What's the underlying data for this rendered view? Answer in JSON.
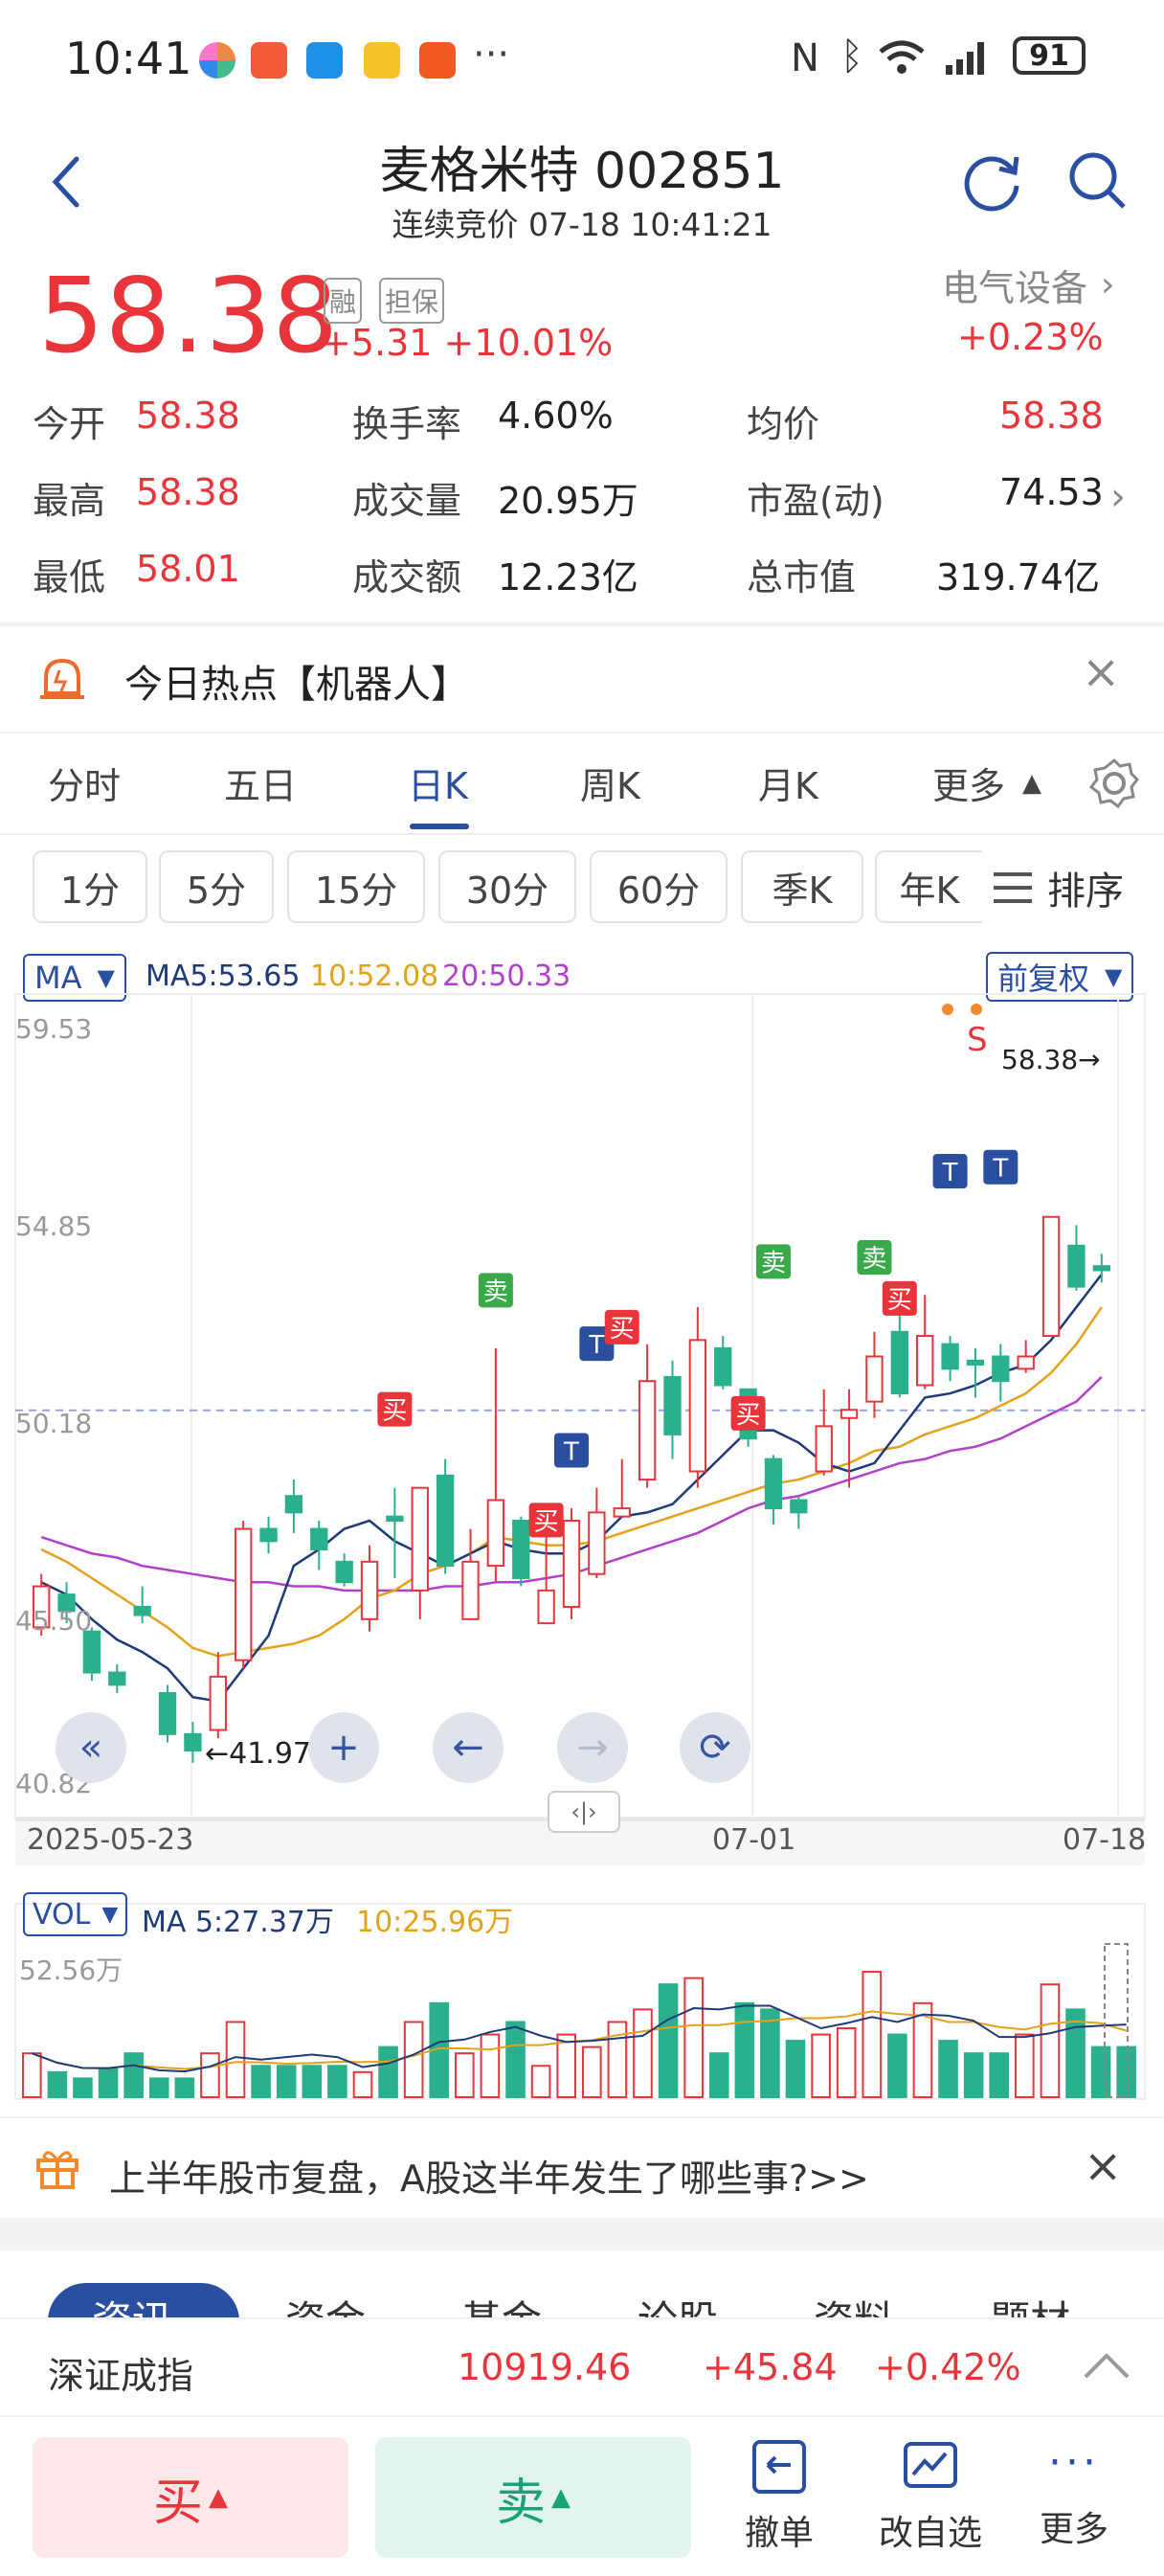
{
  "status_bar": {
    "time": "10:41",
    "battery": "91",
    "dots": "···"
  },
  "header": {
    "title": "麦格米特 002851",
    "subtitle": "连续竞价 07-18 10:41:21"
  },
  "quote": {
    "price": "58.38",
    "tag_rong": "融",
    "tag_danbao": "担保",
    "change": "+5.31",
    "change_pct": "+10.01%",
    "sector": "电气设备",
    "sector_pct": "+0.23%"
  },
  "stats": [
    {
      "label": "今开",
      "value": "58.38"
    },
    {
      "label": "换手率",
      "value": "4.60%"
    },
    {
      "label": "均价",
      "value": "58.38"
    },
    {
      "label": "最高",
      "value": "58.38"
    },
    {
      "label": "成交量",
      "value": "20.95万"
    },
    {
      "label": "市盈(动)",
      "value": "74.53"
    },
    {
      "label": "最低",
      "value": "58.01"
    },
    {
      "label": "成交额",
      "value": "12.23亿"
    },
    {
      "label": "总市值",
      "value": "319.74亿"
    }
  ],
  "hot_topic": {
    "text": "今日热点【机器人】"
  },
  "tabs": [
    "分时",
    "五日",
    "日K",
    "周K",
    "月K",
    "更多"
  ],
  "active_tab": "日K",
  "periods": [
    "1分",
    "5分",
    "15分",
    "30分",
    "60分",
    "季K",
    "年K"
  ],
  "sort_label": "排序",
  "chart_header": {
    "indicator": "MA",
    "ma5": "MA5:53.65",
    "ma10": "10:52.08",
    "ma20": "20:50.33",
    "adjust": "前复权"
  },
  "vol_header": {
    "indicator": "VOL",
    "ma5": "MA 5:27.37万",
    "ma10": "10:25.96万",
    "max": "52.56万"
  },
  "colors": {
    "up": "#e8353b",
    "down": "#2bb08e",
    "ma5": "#1e3a78",
    "ma10": "#e3a21a",
    "ma20": "#b241c9",
    "accent": "#2b4fa0"
  },
  "chart_data": {
    "type": "candlestick",
    "y_ticks": [
      "59.53",
      "54.85",
      "50.18",
      "45.50",
      "40.82"
    ],
    "ylim": [
      40.82,
      59.53
    ],
    "x_labels": [
      "2025-05-23",
      "07-01",
      "07-18"
    ],
    "last_price_label": "58.38→",
    "low_marker": "←41.97",
    "s_marker": "S",
    "t_marker": "T",
    "signal_buy": "买",
    "signal_sell": "卖",
    "candles": [
      [
        44.8,
        45.8,
        44.6,
        46.1
      ],
      [
        45.6,
        45.2,
        44.9,
        45.9
      ],
      [
        44.7,
        43.7,
        43.5,
        44.8
      ],
      [
        43.7,
        43.4,
        43.2,
        43.9
      ],
      [
        45.3,
        45.1,
        44.9,
        45.8
      ],
      [
        43.2,
        42.2,
        42.0,
        43.4
      ],
      [
        42.2,
        41.8,
        41.5,
        42.5
      ],
      [
        42.3,
        43.6,
        42.1,
        44.2
      ],
      [
        44.0,
        47.2,
        43.8,
        47.4
      ],
      [
        47.2,
        46.9,
        46.6,
        47.5
      ],
      [
        48.0,
        47.6,
        47.1,
        48.4
      ],
      [
        47.2,
        46.7,
        46.2,
        47.4
      ],
      [
        46.4,
        45.9,
        45.8,
        46.6
      ],
      [
        45.0,
        46.4,
        44.7,
        46.8
      ],
      [
        47.5,
        47.4,
        46.0,
        48.2
      ],
      [
        45.7,
        48.2,
        45.0,
        48.2
      ],
      [
        48.5,
        46.3,
        46.1,
        48.9
      ],
      [
        45.0,
        46.4,
        45.0,
        47.2
      ],
      [
        46.3,
        47.9,
        45.9,
        51.6
      ],
      [
        47.4,
        46.0,
        45.8,
        47.5
      ],
      [
        44.9,
        45.7,
        44.9,
        47.3
      ],
      [
        45.3,
        47.4,
        45.0,
        47.7
      ],
      [
        46.1,
        47.6,
        46.0,
        48.2
      ],
      [
        47.5,
        47.7,
        47.5,
        48.9
      ],
      [
        48.4,
        50.8,
        48.2,
        51.7
      ],
      [
        50.9,
        49.5,
        48.9,
        51.3
      ],
      [
        48.6,
        51.8,
        48.2,
        52.6
      ],
      [
        51.6,
        50.7,
        50.6,
        51.9
      ],
      [
        50.6,
        49.4,
        49.2,
        50.6
      ],
      [
        48.9,
        47.7,
        47.3,
        49.0
      ],
      [
        47.9,
        47.6,
        47.2,
        48.0
      ],
      [
        48.6,
        49.7,
        48.5,
        50.6
      ],
      [
        49.9,
        50.1,
        48.2,
        50.6
      ],
      [
        50.3,
        51.4,
        49.9,
        52.0
      ],
      [
        52.0,
        50.5,
        50.4,
        52.7
      ],
      [
        50.7,
        51.9,
        50.6,
        52.9
      ],
      [
        51.7,
        51.1,
        50.8,
        51.9
      ],
      [
        51.3,
        51.2,
        50.4,
        51.6
      ],
      [
        51.4,
        50.8,
        50.3,
        51.7
      ],
      [
        51.1,
        51.4,
        51.0,
        51.8
      ],
      [
        51.9,
        54.8,
        51.9,
        54.8
      ],
      [
        54.1,
        53.1,
        53.0,
        54.6
      ],
      [
        53.6,
        53.5,
        53.2,
        53.9
      ]
    ],
    "ma5_series": [
      45.9,
      45.6,
      45.0,
      44.5,
      44.2,
      43.8,
      43.1,
      43.0,
      43.8,
      44.6,
      46.3,
      46.7,
      47.2,
      47.4,
      46.9,
      46.6,
      46.3,
      46.6,
      46.9,
      46.7,
      46.6,
      46.6,
      46.9,
      47.5,
      47.6,
      47.8,
      48.4,
      49.0,
      49.6,
      49.6,
      49.3,
      48.8,
      48.6,
      48.8,
      49.6,
      50.4,
      50.5,
      50.7,
      51.0,
      51.2,
      51.8,
      52.6,
      53.4
    ],
    "ma10_series": [
      46.7,
      46.4,
      46.0,
      45.6,
      45.2,
      44.8,
      44.3,
      44.1,
      44.2,
      44.3,
      44.4,
      44.6,
      45.0,
      45.5,
      45.7,
      46.1,
      46.3,
      46.6,
      47.0,
      46.9,
      46.8,
      46.8,
      46.9,
      47.1,
      47.3,
      47.5,
      47.7,
      47.9,
      48.1,
      48.3,
      48.4,
      48.6,
      48.8,
      49.1,
      49.2,
      49.5,
      49.7,
      49.9,
      50.2,
      50.5,
      51.0,
      51.7,
      52.6
    ],
    "ma20_series": [
      47.0,
      46.8,
      46.6,
      46.5,
      46.3,
      46.2,
      46.1,
      46.0,
      45.9,
      45.9,
      45.8,
      45.8,
      45.7,
      45.7,
      45.7,
      45.7,
      45.8,
      45.8,
      45.9,
      45.9,
      46.0,
      46.1,
      46.3,
      46.5,
      46.7,
      46.9,
      47.1,
      47.4,
      47.7,
      47.9,
      48.0,
      48.2,
      48.4,
      48.6,
      48.8,
      48.9,
      49.1,
      49.2,
      49.4,
      49.7,
      50.0,
      50.3,
      50.9
    ],
    "volumes": [
      14,
      8,
      6,
      9,
      14,
      6,
      6,
      14,
      24,
      10,
      10,
      10,
      10,
      8,
      16,
      24,
      30,
      14,
      20,
      24,
      10,
      20,
      16,
      24,
      28,
      36,
      38,
      14,
      30,
      28,
      18,
      20,
      22,
      40,
      20,
      30,
      18,
      14,
      14,
      20,
      36,
      28,
      16,
      16
    ]
  },
  "promo": {
    "text": "上半年股市复盘，A股这半年发生了哪些事?>>"
  },
  "info_tabs": [
    "资讯",
    "资金",
    "基金",
    "论股",
    "资料",
    "题材"
  ],
  "index_bar": {
    "name": "深证成指",
    "value": "10919.46",
    "change": "+45.84",
    "pct": "+0.42%"
  },
  "bottom": {
    "buy": "买",
    "sell": "卖",
    "cancel": "撤单",
    "edit": "改自选",
    "more": "更多"
  }
}
